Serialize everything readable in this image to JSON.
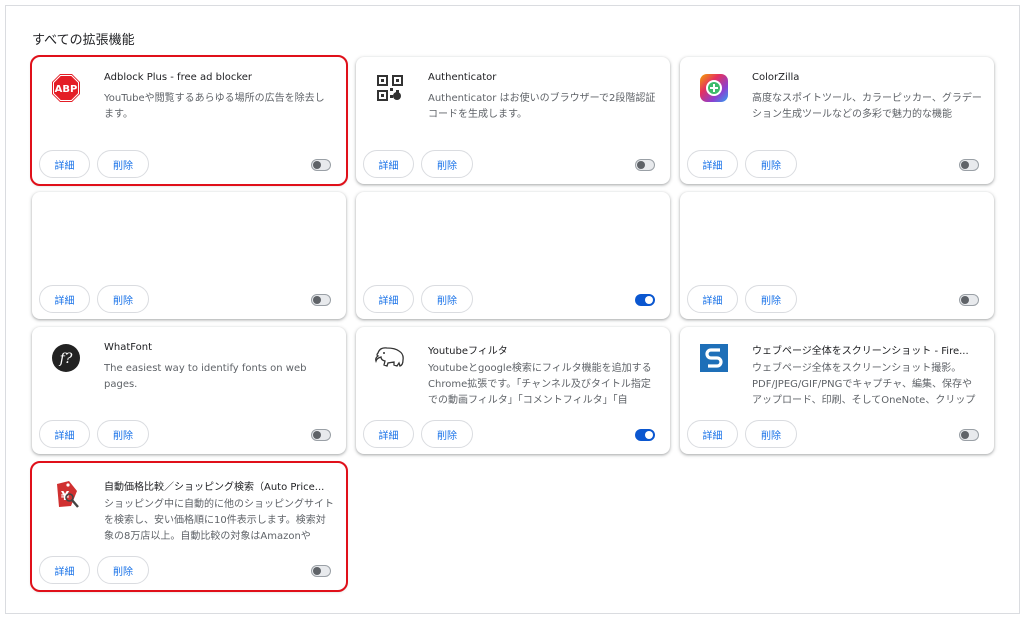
{
  "section_title": "すべての拡張機能",
  "buttons": {
    "details": "詳細",
    "remove": "削除"
  },
  "colors": {
    "accent": "#1a73e8",
    "toggle_on": "#0b57d0",
    "highlight": "#e0101a"
  },
  "cards": [
    {
      "name": "Adblock Plus - free ad blocker",
      "description": "YouTubeや閲覧するあらゆる場所の広告を除去します。",
      "icon": "adblock-plus-icon",
      "enabled": false,
      "highlighted": true
    },
    {
      "name": "Authenticator",
      "description": "Authenticator はお使いのブラウザーで2段階認証コードを生成します。",
      "icon": "qr-code-icon",
      "enabled": false,
      "highlighted": false
    },
    {
      "name": "ColorZilla",
      "description": "高度なスポイトツール、カラーピッカー、グラデーション生成ツールなどの多彩で魅力的な機能",
      "icon": "colorzilla-icon",
      "enabled": false,
      "highlighted": false
    },
    {
      "name": "",
      "description": "",
      "icon": "",
      "enabled": false,
      "highlighted": false
    },
    {
      "name": "",
      "description": "",
      "icon": "",
      "enabled": true,
      "highlighted": false
    },
    {
      "name": "",
      "description": "",
      "icon": "",
      "enabled": false,
      "highlighted": false
    },
    {
      "name": "WhatFont",
      "description": "The easiest way to identify fonts on web pages.",
      "icon": "whatfont-icon",
      "enabled": false,
      "highlighted": false
    },
    {
      "name": "Youtubeフィルタ",
      "description": "Youtubeとgoogle検索にフィルタ機能を追加するChrome拡張です。「チャンネル及びタイトル指定での動画フィルタ」「コメントフィルタ」「自",
      "icon": "elephant-icon",
      "enabled": true,
      "highlighted": false
    },
    {
      "name": "ウェブページ全体をスクリーンショット - Fire...",
      "description": "ウェブページ全体をスクリーンショット撮影。PDF/JPEG/GIF/PNGでキャプチャ、編集、保存やアップロード、印刷、そしてOneNote、クリップ",
      "icon": "fireshot-icon",
      "enabled": false,
      "highlighted": false
    },
    {
      "name": "自動価格比較／ショッピング検索（Auto Price...",
      "description": "ショッピング中に自動的に他のショッピングサイトを検索し、安い価格順に10件表示します。検索対象の8万店以上。自動比較の対象はAmazonや",
      "icon": "price-tag-icon",
      "enabled": false,
      "highlighted": true
    }
  ]
}
